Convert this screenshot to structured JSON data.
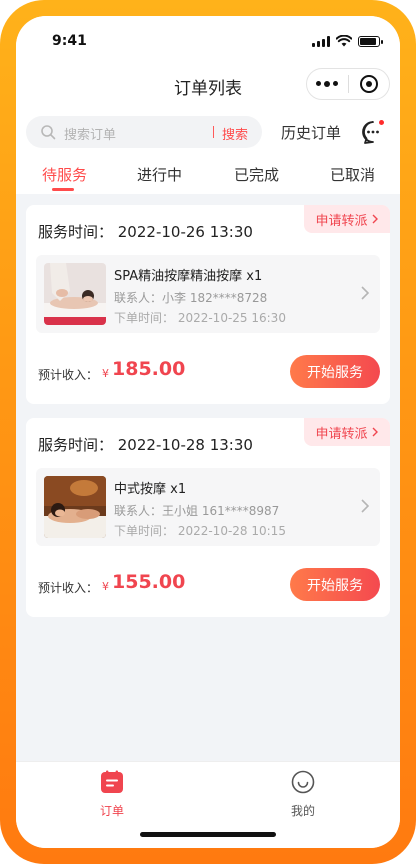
{
  "status_bar": {
    "time": "9:41",
    "battery_level": 0.9
  },
  "navbar": {
    "title": "订单列表"
  },
  "search": {
    "placeholder": "搜索订单",
    "button_label": "搜索",
    "history_label": "历史订单"
  },
  "tabs": [
    {
      "label": "待服务",
      "active": true
    },
    {
      "label": "进行中",
      "active": false
    },
    {
      "label": "已完成",
      "active": false
    },
    {
      "label": "已取消",
      "active": false
    }
  ],
  "orders": [
    {
      "transfer_label": "申请转派",
      "service_time": "服务时间：  2022-10-26 13:30",
      "item_name": "SPA精油按摩精油按摩 x1",
      "contact": "联系人：小李  182****8728",
      "order_time": "下单时间：  2022-10-25 16:30",
      "income_label": "预计收入：",
      "currency": "¥",
      "amount": "185.00",
      "action_label": "开始服务"
    },
    {
      "transfer_label": "申请转派",
      "service_time": "服务时间：  2022-10-28 13:30",
      "item_name": "中式按摩  x1",
      "contact": "联系人：王小姐  161****8987",
      "order_time": "下单时间：  2022-10-28 10:15",
      "income_label": "预计收入：",
      "currency": "¥",
      "amount": "155.00",
      "action_label": "开始服务"
    }
  ],
  "bottom_tabs": [
    {
      "label": "订单",
      "icon": "order-icon",
      "active": true
    },
    {
      "label": "我的",
      "icon": "profile-icon",
      "active": false
    }
  ],
  "colors": {
    "accent": "#ff4b4b",
    "frame": "#ff9a14",
    "tag_bg": "#ffe8ea"
  }
}
